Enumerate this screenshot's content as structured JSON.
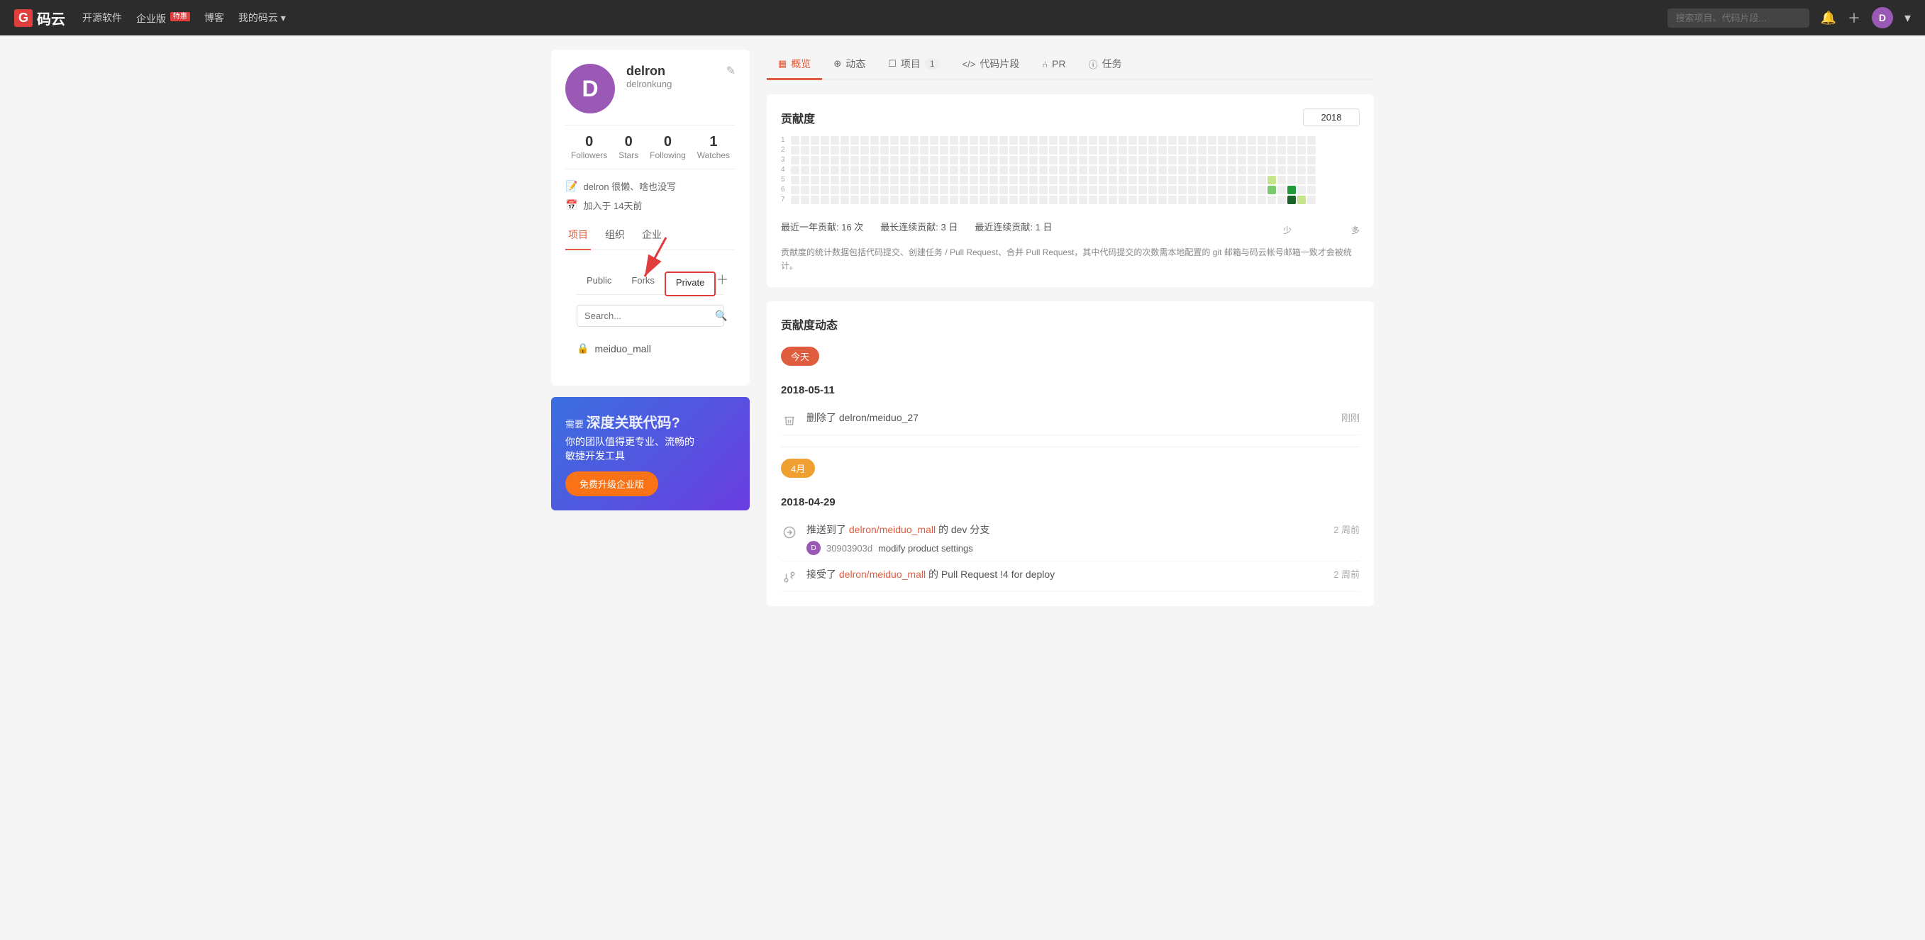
{
  "navbar": {
    "logo_g": "G",
    "logo_text": "码云",
    "links": [
      {
        "label": "开源软件",
        "badge": null
      },
      {
        "label": "企业版",
        "badge": "特惠"
      },
      {
        "label": "博客",
        "badge": null
      },
      {
        "label": "我的码云",
        "badge": null,
        "dropdown": true
      }
    ],
    "search_placeholder": "搜索项目、代码片段...",
    "avatar_letter": "D"
  },
  "sidebar": {
    "avatar_letter": "D",
    "name": "delron",
    "username": "delronkung",
    "stats": [
      {
        "number": "0",
        "label": "Followers"
      },
      {
        "number": "0",
        "label": "Stars"
      },
      {
        "number": "0",
        "label": "Following"
      },
      {
        "number": "1",
        "label": "Watches"
      }
    ],
    "bio": "delron 很懒、啥也没写",
    "joined": "加入于 14天前",
    "profile_tabs": [
      {
        "label": "项目",
        "active": true
      },
      {
        "label": "组织",
        "active": false
      },
      {
        "label": "企业",
        "active": false
      }
    ],
    "repo_tabs": [
      {
        "label": "Public",
        "active": false
      },
      {
        "label": "Forks",
        "active": false
      },
      {
        "label": "Private",
        "active": true
      }
    ],
    "search_placeholder": "Search...",
    "repos": [
      {
        "name": "meiduo_mall",
        "private": true
      }
    ],
    "ad": {
      "line1": "深度关联代码?",
      "line2": "需要",
      "subtitle1": "你的团队值得更专业、流畅的",
      "subtitle2": "敏捷开发工具",
      "btn": "免费升级企业版"
    }
  },
  "main": {
    "tabs": [
      {
        "label": "概览",
        "icon": "grid",
        "active": true,
        "count": null
      },
      {
        "label": "动态",
        "icon": "activity",
        "active": false,
        "count": null
      },
      {
        "label": "项目",
        "icon": "folder",
        "active": false,
        "count": "1"
      },
      {
        "label": "代码片段",
        "icon": "code",
        "active": false,
        "count": null
      },
      {
        "label": "PR",
        "icon": "git-merge",
        "active": false,
        "count": null
      },
      {
        "label": "任务",
        "icon": "task",
        "active": false,
        "count": null
      }
    ],
    "contribution": {
      "title": "贡献度",
      "year": "2018",
      "stats_text1": "最近一年贡献: 16 次",
      "stats_text2": "最长连续贡献: 3 日",
      "stats_text3": "最近连续贡献: 1 日",
      "legend_low": "少",
      "legend_high": "多",
      "desc": "贡献度的统计数据包括代码提交、创建任务 / Pull Request、合并 Pull Request，其中代码提交的次数需本地配置的 git 邮箱与码云帐号邮箱一致才会被统计。"
    },
    "activity": {
      "title": "贡献度动态",
      "groups": [
        {
          "badge": "今天",
          "badge_color": "orange",
          "dates": [
            {
              "date": "2018-05-11",
              "items": [
                {
                  "type": "delete",
                  "text": "删除了 delron/meiduo_27",
                  "time": "刚刚",
                  "link": null
                }
              ]
            }
          ]
        },
        {
          "badge": "4月",
          "badge_color": "orange",
          "dates": [
            {
              "date": "2018-04-29",
              "items": [
                {
                  "type": "push",
                  "text_prefix": "推送到了 ",
                  "link_text": "delron/meiduo_mall",
                  "text_suffix": " 的 dev 分支",
                  "time": "2 周前",
                  "commit": {
                    "hash": "30903903d",
                    "msg": "modify product settings"
                  }
                },
                {
                  "type": "pr",
                  "text_prefix": "接受了 ",
                  "link_text": "delron/meiduo_mall",
                  "text_suffix": " 的 Pull Request !4 for deploy",
                  "time": "2 周前"
                }
              ]
            }
          ]
        }
      ]
    }
  },
  "colors": {
    "brand_red": "#e05c3e",
    "nav_bg": "#2c2c2c",
    "accent_orange": "#f0a030",
    "avatar_purple": "#9b59b6"
  }
}
